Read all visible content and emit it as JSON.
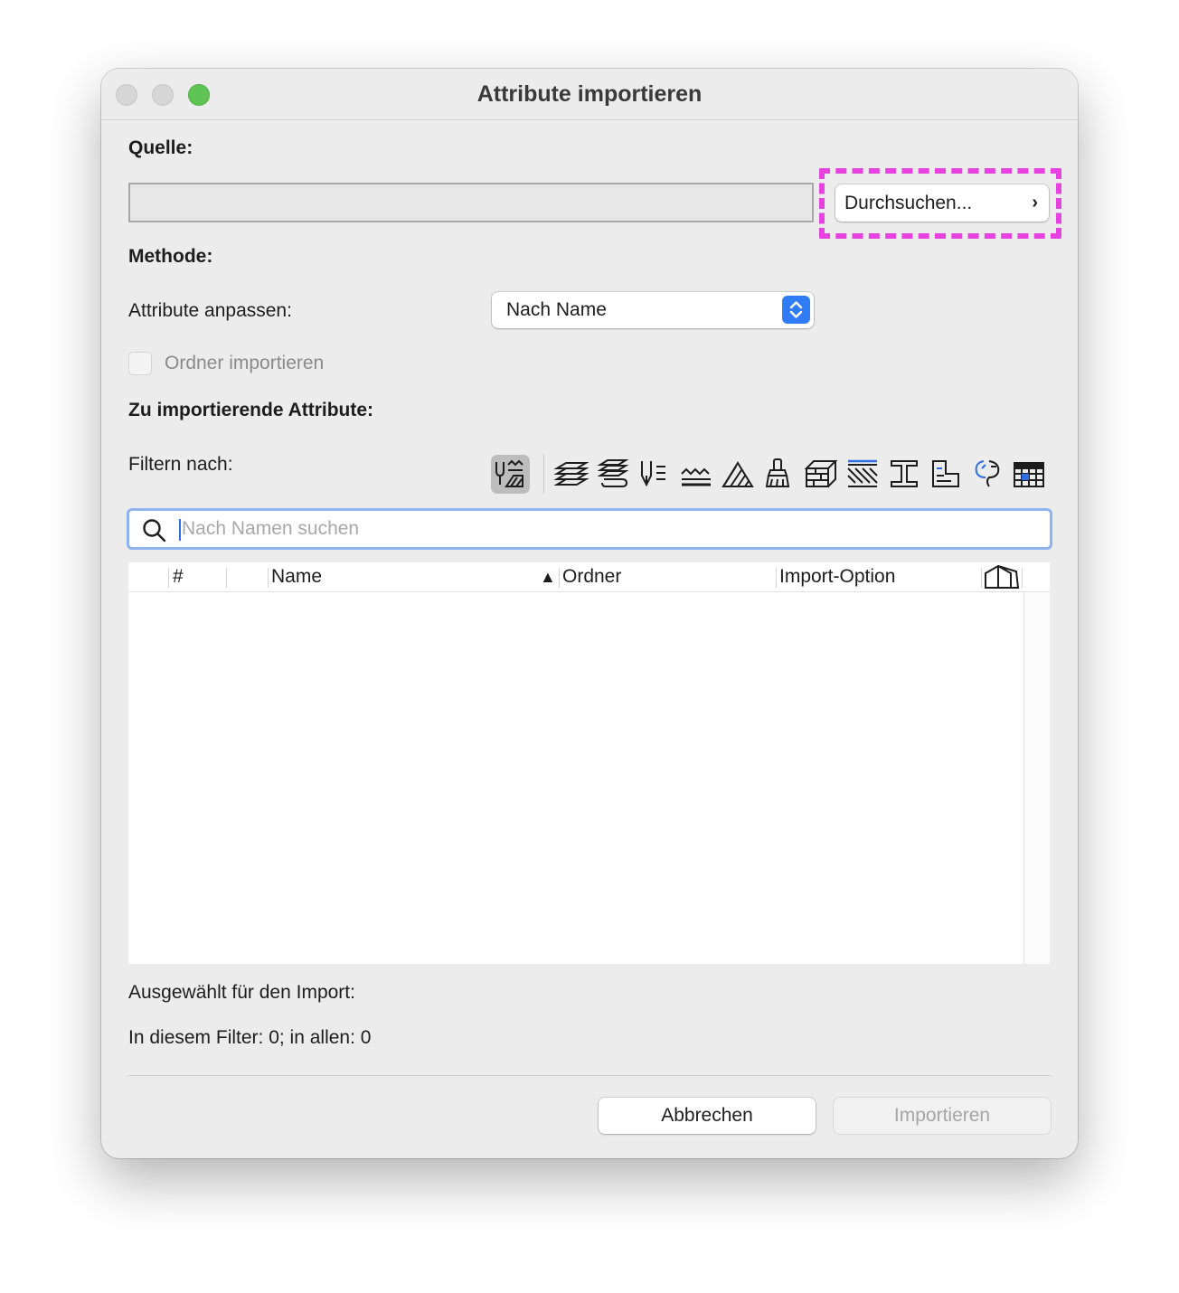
{
  "window": {
    "title": "Attribute importieren"
  },
  "source": {
    "label": "Quelle:",
    "path": "",
    "browse_label": "Durchsuchen...",
    "browse_chevron": "›"
  },
  "method": {
    "label": "Methode:",
    "match_label": "Attribute anpassen:",
    "match_value": "Nach Name",
    "folder_checkbox_label": "Ordner importieren",
    "folder_checked": false
  },
  "attributes": {
    "label": "Zu importierende Attribute:",
    "filter_label": "Filtern nach:",
    "filter_icons": [
      "all-attributes-icon",
      "layers-icon",
      "layer-combinations-icon",
      "pens-icon",
      "line-types-icon",
      "fill-types-icon",
      "surfaces-icon",
      "building-materials-icon",
      "composites-icon",
      "profiles-icon",
      "zones-icon",
      "mep-systems-icon",
      "operation-profiles-icon"
    ],
    "active_filter": "all-attributes-icon"
  },
  "search": {
    "placeholder": "Nach Namen suchen",
    "value": ""
  },
  "table": {
    "columns": [
      "#",
      "Name",
      "Ordner",
      "Import-Option"
    ],
    "sort_indicator": "▲",
    "rows": []
  },
  "summary": {
    "selected_label": "Ausgewählt für den Import:",
    "count_text": "In diesem Filter: 0; in allen: 0"
  },
  "buttons": {
    "cancel": "Abbrechen",
    "import": "Importieren"
  },
  "colors": {
    "accent": "#2f7cf6",
    "highlight": "#e642e0",
    "traffic_green": "#5fc454"
  }
}
